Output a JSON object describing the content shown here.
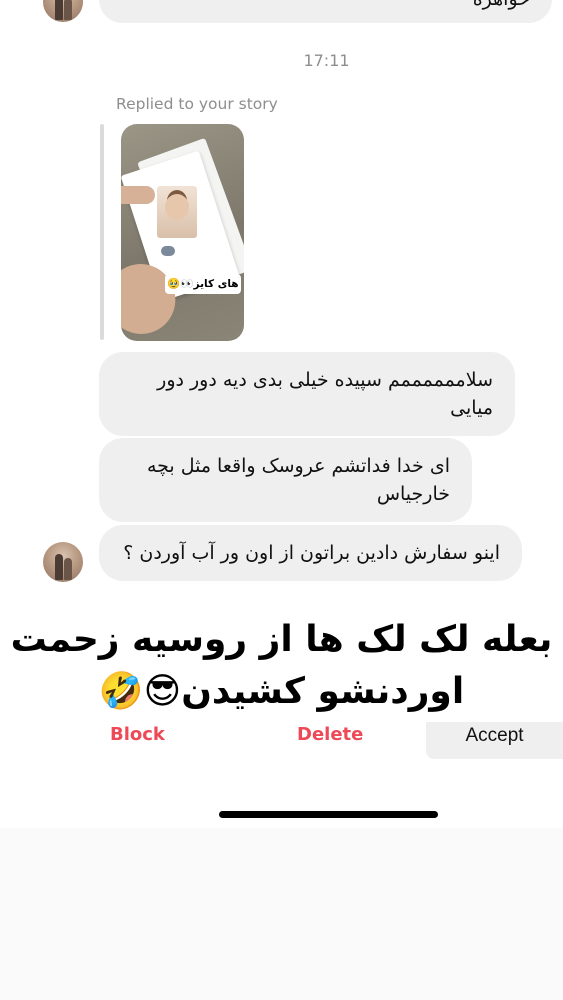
{
  "thread": {
    "top_partial_message": "خواهره",
    "timestamp": "17:11",
    "replied_label": "Replied to your story",
    "story_sticker": "های کایز👀🥹",
    "messages": [
      {
        "text": "سلاممممممم سپیده خیلی بدی دیه دور دور میایی"
      },
      {
        "text": "ای خدا فداتشم عروسک واقعا مثل بچه خارجیاس"
      },
      {
        "text": "اینو سفارش دادین براتون از اون ور آب آوردن ؟"
      }
    ]
  },
  "request_bar": {
    "block_label": "Block",
    "delete_label": "Delete",
    "accept_label": "Accept"
  },
  "overlay_caption": {
    "line1": "بعله لک لک ها از روسیه زحمت",
    "line2": "اوردنشو کشیدن😎🤣"
  },
  "colors": {
    "bubble_bg": "#efefef",
    "meta_text": "#8e8e8e",
    "destructive": "#ed4956"
  }
}
